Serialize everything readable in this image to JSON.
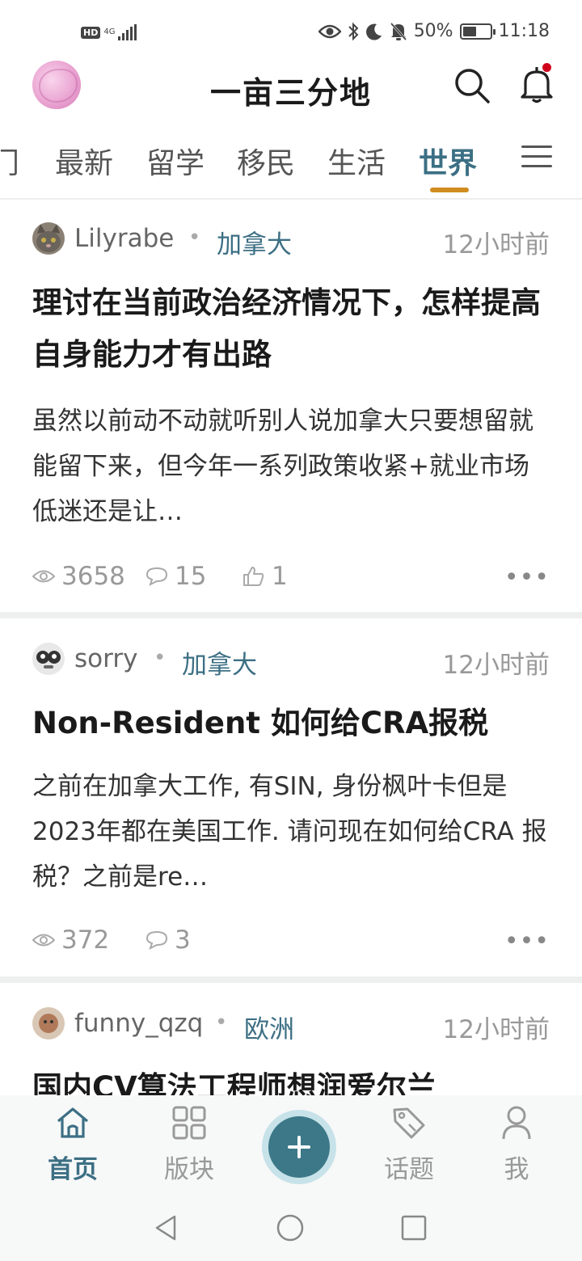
{
  "status_bar": {
    "hd": "HD",
    "network": "4G",
    "battery_text": "50%",
    "battery_level": 0.5,
    "time": "11:18",
    "icons": [
      "eye-icon",
      "bluetooth-icon",
      "moon-icon",
      "mute-icon",
      "battery-icon"
    ]
  },
  "header": {
    "title": "一亩三分地",
    "icons": [
      "search-icon",
      "bell-icon"
    ]
  },
  "tabs": {
    "items": [
      {
        "label": "门"
      },
      {
        "label": "最新"
      },
      {
        "label": "留学"
      },
      {
        "label": "移民"
      },
      {
        "label": "生活"
      },
      {
        "label": "世界",
        "active": true
      }
    ],
    "accent_color": "#3c6f84",
    "underline_color": "#d08c1f"
  },
  "posts": [
    {
      "author": "Lilyrabe",
      "board": "加拿大",
      "time": "12小时前",
      "title": "理讨在当前政治经济情况下，怎样提高自身能力才有出路",
      "excerpt": "虽然以前动不动就听别人说加拿大只要想留就能留下来，但今年一系列政策收紧+就业市场低迷还是让…",
      "views": "3658",
      "comments": "15",
      "likes": "1"
    },
    {
      "author": "sorry",
      "board": "加拿大",
      "time": "12小时前",
      "title": "Non-Resident 如何给CRA报税",
      "excerpt": "之前在加拿大工作, 有SIN, 身份枫叶卡但是2023年都在美国工作. 请问现在如何给CRA 报税？之前是re…",
      "views": "372",
      "comments": "3"
    },
    {
      "author": "funny_qzq",
      "board": "欧洲",
      "time": "12小时前",
      "title": "国内CV算法工程师想润爱尔兰"
    }
  ],
  "bottom_nav": {
    "items": [
      {
        "label": "首页",
        "icon": "home-icon",
        "active": true
      },
      {
        "label": "版块",
        "icon": "grid-icon"
      },
      {
        "label": "话题",
        "icon": "tag-icon"
      },
      {
        "label": "我",
        "icon": "person-icon"
      }
    ],
    "fab_icon": "plus-icon"
  },
  "system_nav": [
    "back-icon",
    "home-circle-icon",
    "recents-icon"
  ]
}
